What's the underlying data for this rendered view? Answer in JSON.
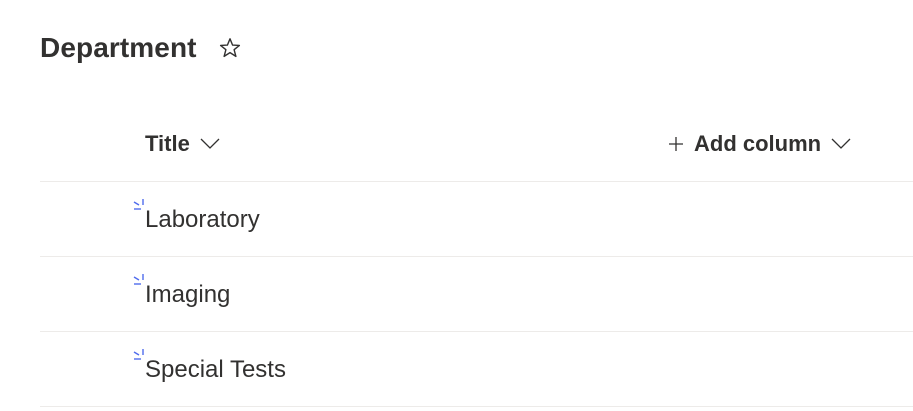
{
  "page": {
    "title": "Department",
    "favorite_icon": "star-outline-icon"
  },
  "columns": {
    "title_label": "Title",
    "add_column_label": "Add column"
  },
  "rows": [
    {
      "title": "Laboratory",
      "badge_icon": "new-item-indicator-icon"
    },
    {
      "title": "Imaging",
      "badge_icon": "new-item-indicator-icon"
    },
    {
      "title": "Special Tests",
      "badge_icon": "new-item-indicator-icon"
    }
  ],
  "colors": {
    "text": "#323130",
    "divider": "#edebe9",
    "new_indicator": "#4f6bed"
  }
}
